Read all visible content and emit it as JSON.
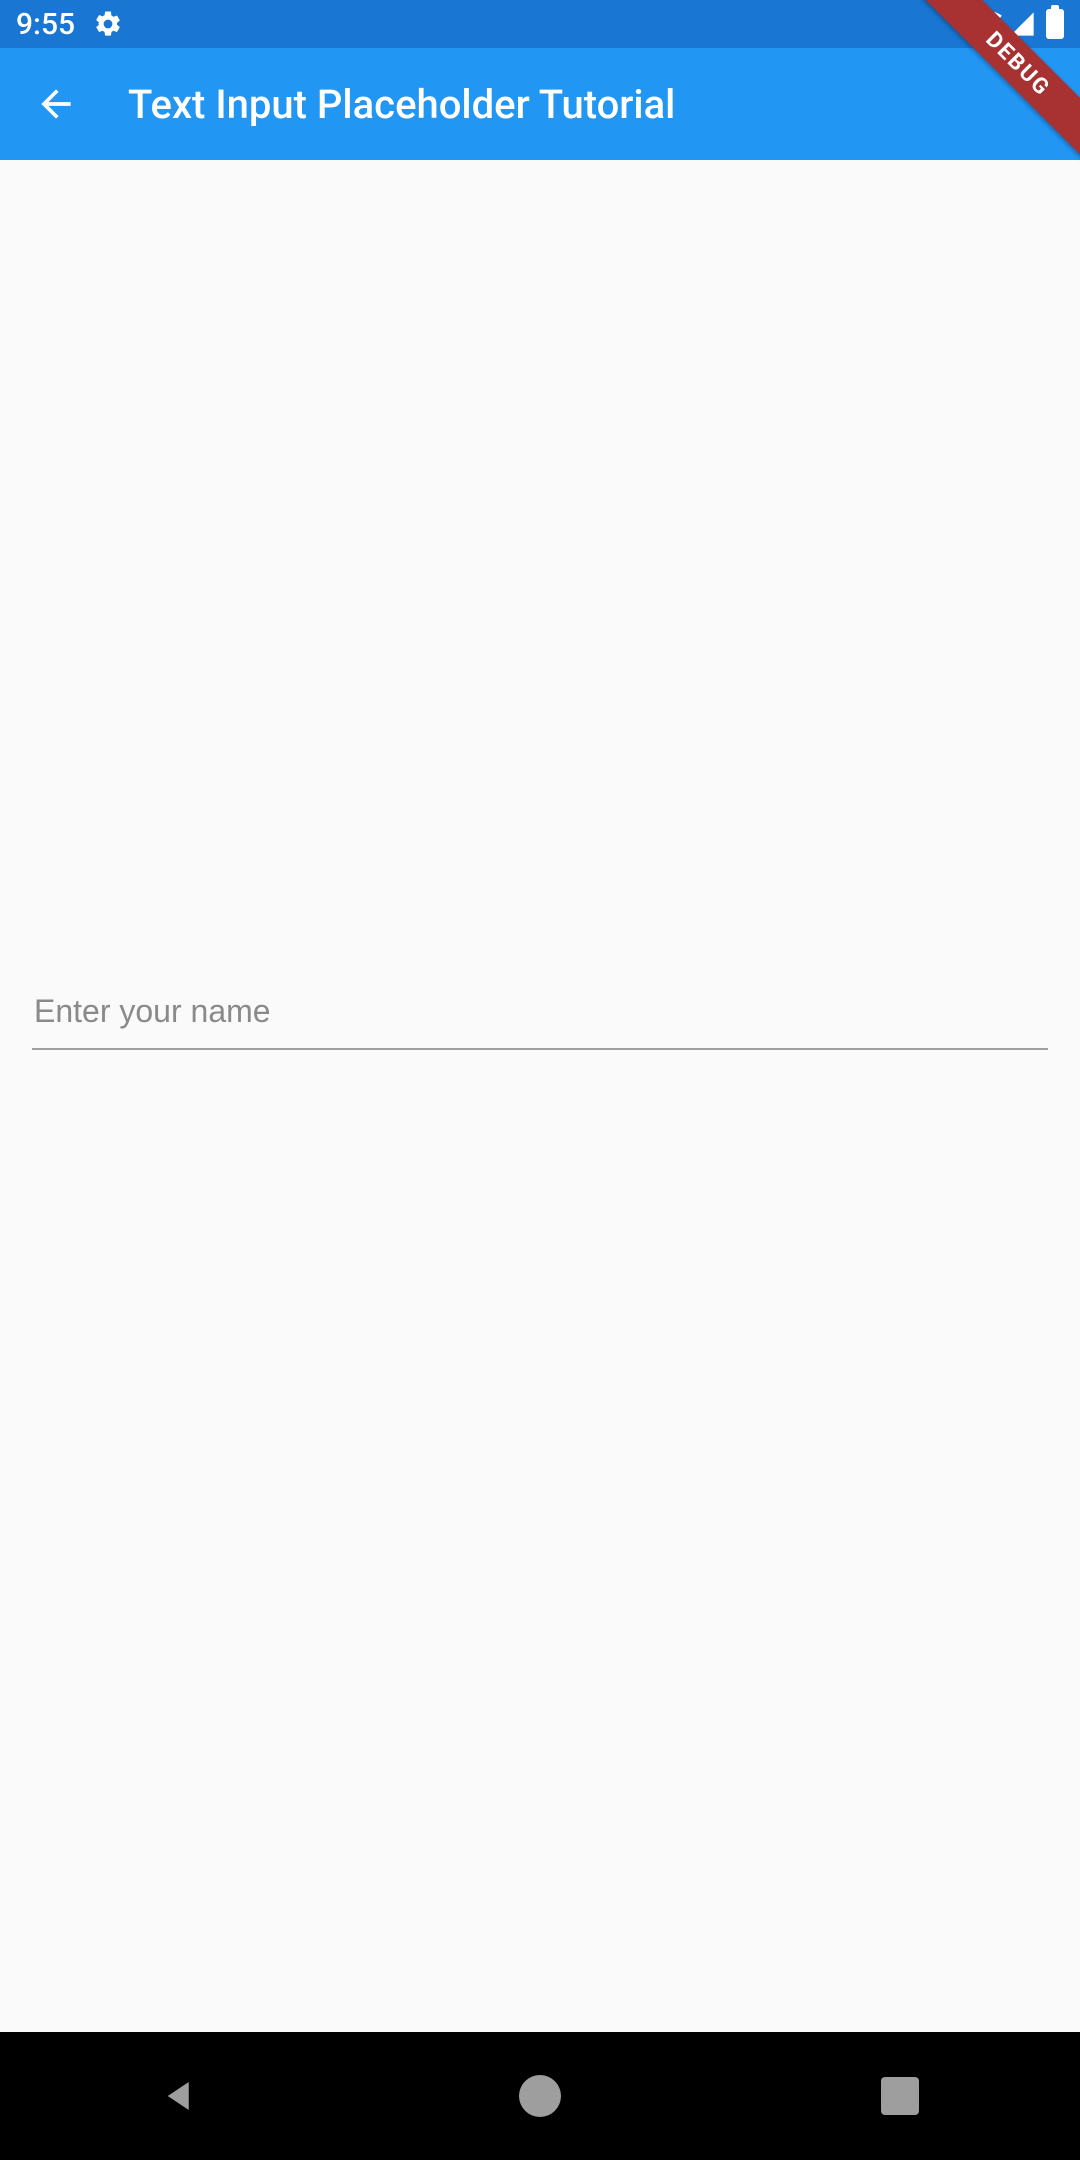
{
  "status": {
    "time": "9:55",
    "icons": {
      "gear": "gear-icon",
      "wifi": "wifi-icon",
      "signal": "signal-icon",
      "battery": "battery-icon"
    }
  },
  "appbar": {
    "title": "Text Input Placeholder Tutorial",
    "back_label": "Back"
  },
  "form": {
    "name_placeholder": "Enter your name",
    "name_value": ""
  },
  "debug": {
    "label": "DEBUG"
  },
  "nav": {
    "back": "nav-back",
    "home": "nav-home",
    "recent": "nav-recent"
  },
  "colors": {
    "status_bar": "#1976d2",
    "app_bar": "#2196f3",
    "bg": "#fafafa",
    "hint": "#8a8a8a",
    "debug": "#a83232"
  }
}
